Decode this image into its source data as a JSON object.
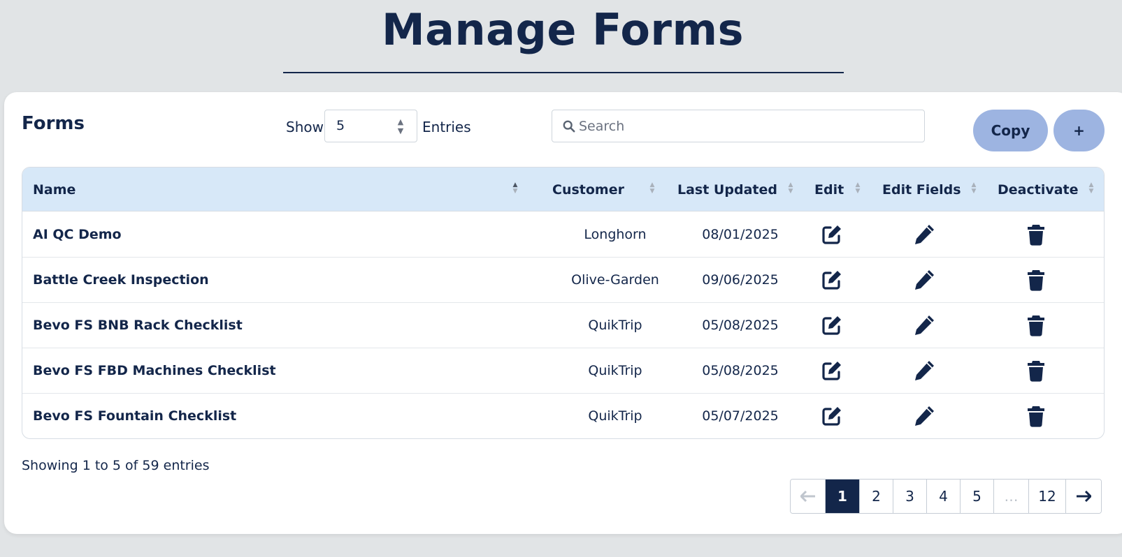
{
  "page": {
    "title": "Manage Forms"
  },
  "card": {
    "title": "Forms",
    "show_label": "Show",
    "entries_value": "5",
    "entries_label": "Entries",
    "search_placeholder": "Search",
    "copy_label": "Copy",
    "add_label": "+"
  },
  "table": {
    "columns": [
      "Name",
      "Customer",
      "Last Updated",
      "Edit",
      "Edit Fields",
      "Deactivate"
    ],
    "rows": [
      {
        "name": "AI QC Demo",
        "customer": "Longhorn",
        "updated": "08/01/2025"
      },
      {
        "name": "Battle Creek Inspection",
        "customer": "Olive-Garden",
        "updated": "09/06/2025"
      },
      {
        "name": "Bevo FS BNB Rack Checklist",
        "customer": "QuikTrip",
        "updated": "05/08/2025"
      },
      {
        "name": "Bevo FS FBD Machines Checklist",
        "customer": "QuikTrip",
        "updated": "05/08/2025"
      },
      {
        "name": "Bevo FS Fountain Checklist",
        "customer": "QuikTrip",
        "updated": "05/07/2025"
      }
    ],
    "row_icons": {
      "edit": "edit-square-icon",
      "edit_fields": "pencil-icon",
      "deactivate": "trash-icon"
    }
  },
  "footer": {
    "showing_text": "Showing 1 to 5 of 59 entries",
    "pages": [
      "1",
      "2",
      "3",
      "4",
      "5",
      "…",
      "12"
    ],
    "current_page": "1",
    "prev_icon": "arrow-left-icon",
    "next_icon": "arrow-right-icon"
  },
  "colors": {
    "primary": "#13264a",
    "accent_button": "#9db4e1",
    "table_header": "#d7e8f8",
    "background": "#e1e4e6"
  }
}
